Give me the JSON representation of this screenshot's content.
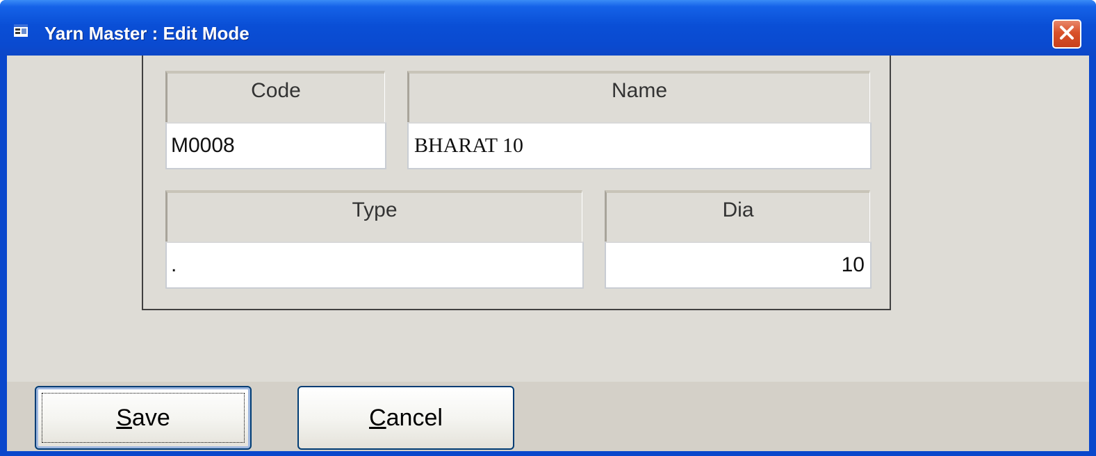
{
  "window": {
    "title": "Yarn Master : Edit Mode",
    "app_icon": "form-window-icon",
    "close_icon": "close-x-icon",
    "accent_color": "#0a4fd6",
    "close_color": "#d9512a"
  },
  "form": {
    "code": {
      "label": "Code",
      "value": "M0008"
    },
    "name": {
      "label": "Name",
      "value": "BHARAT 10"
    },
    "type": {
      "label": "Type",
      "value": "."
    },
    "dia": {
      "label": "Dia",
      "value": "10"
    }
  },
  "buttons": {
    "save": {
      "mnemonic": "S",
      "rest": "ave"
    },
    "cancel": {
      "mnemonic": "C",
      "rest": "ancel"
    }
  }
}
